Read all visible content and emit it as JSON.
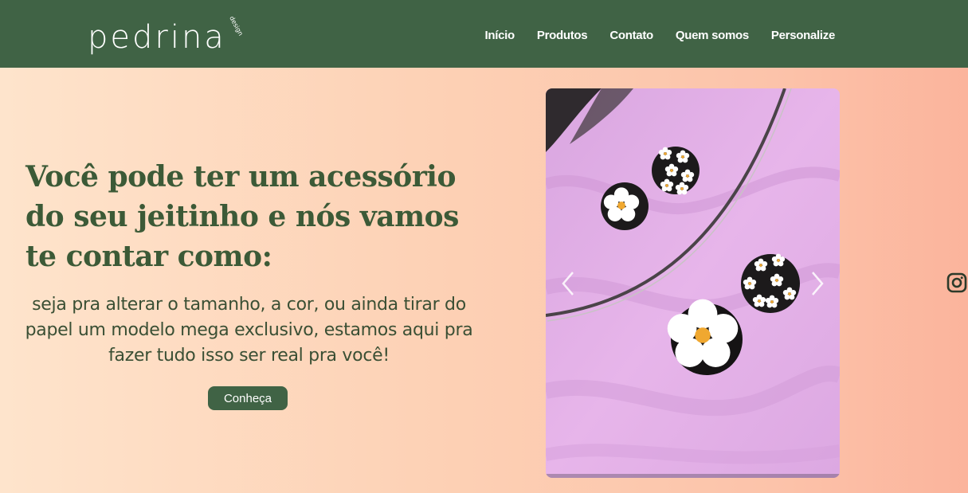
{
  "header": {
    "logo_text": "pedrina",
    "logo_tag": "design",
    "nav": [
      {
        "label": "Início"
      },
      {
        "label": "Produtos"
      },
      {
        "label": "Contato"
      },
      {
        "label": "Quem somos"
      },
      {
        "label": "Personalize"
      }
    ]
  },
  "hero": {
    "headline": "Você pode ter um acessório do seu jeitinho e nós vamos te contar como:",
    "subtext": "seja pra alterar o tamanho, a cor, ou ainda tirar do papel um modelo mega exclusivo, estamos aqui pra fazer tudo isso ser real pra você!",
    "cta_label": "Conheça"
  },
  "carousel": {
    "prev_icon": "chevron-left-icon",
    "next_icon": "chevron-right-icon"
  },
  "social": {
    "icon": "instagram-icon"
  },
  "colors": {
    "brand_green": "#406345",
    "headline_green": "#3c5a37",
    "bg_peach_left": "#fee4cc",
    "bg_peach_right": "#fbb49c"
  }
}
